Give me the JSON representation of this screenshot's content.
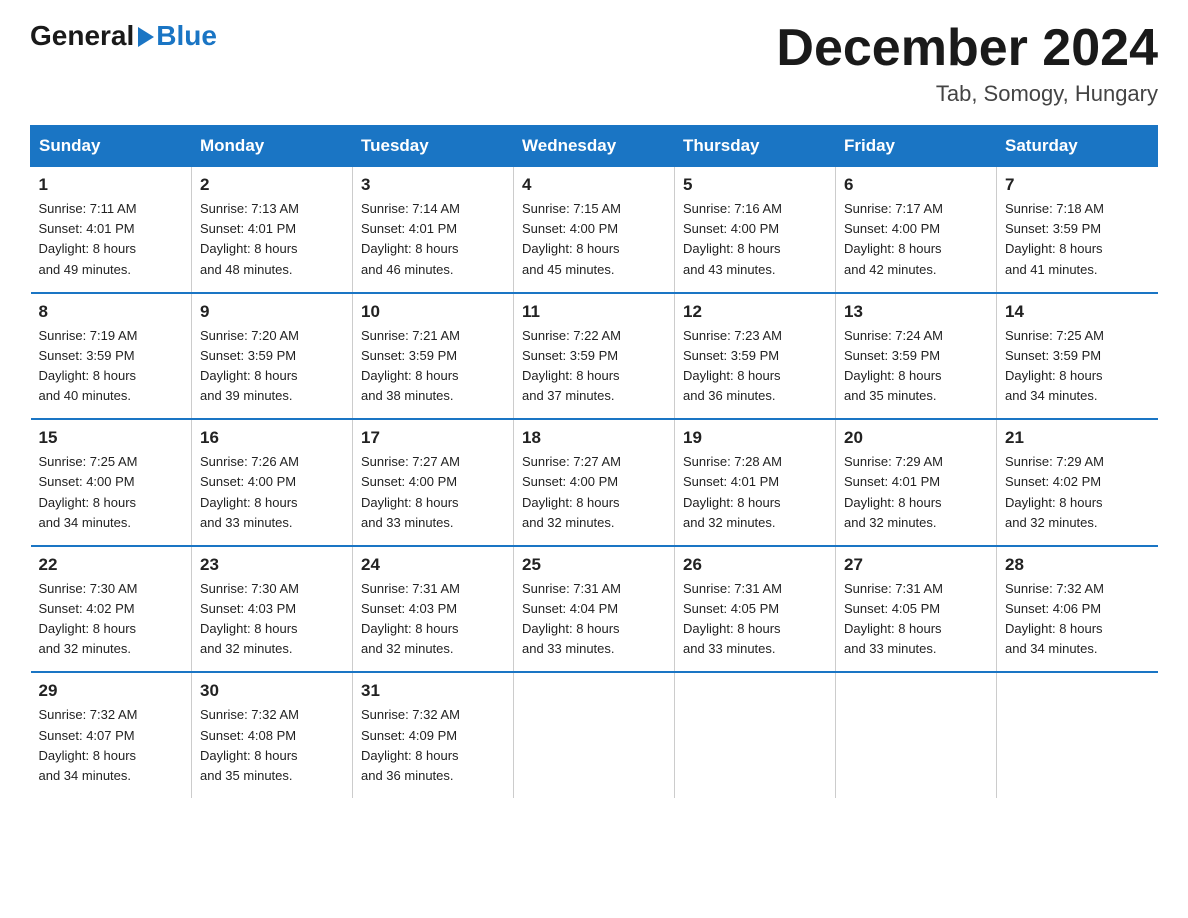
{
  "header": {
    "logo_general": "General",
    "logo_blue": "Blue",
    "month_title": "December 2024",
    "location": "Tab, Somogy, Hungary"
  },
  "days_of_week": [
    "Sunday",
    "Monday",
    "Tuesday",
    "Wednesday",
    "Thursday",
    "Friday",
    "Saturday"
  ],
  "weeks": [
    [
      {
        "day": "1",
        "sunrise": "7:11 AM",
        "sunset": "4:01 PM",
        "daylight": "8 hours and 49 minutes."
      },
      {
        "day": "2",
        "sunrise": "7:13 AM",
        "sunset": "4:01 PM",
        "daylight": "8 hours and 48 minutes."
      },
      {
        "day": "3",
        "sunrise": "7:14 AM",
        "sunset": "4:01 PM",
        "daylight": "8 hours and 46 minutes."
      },
      {
        "day": "4",
        "sunrise": "7:15 AM",
        "sunset": "4:00 PM",
        "daylight": "8 hours and 45 minutes."
      },
      {
        "day": "5",
        "sunrise": "7:16 AM",
        "sunset": "4:00 PM",
        "daylight": "8 hours and 43 minutes."
      },
      {
        "day": "6",
        "sunrise": "7:17 AM",
        "sunset": "4:00 PM",
        "daylight": "8 hours and 42 minutes."
      },
      {
        "day": "7",
        "sunrise": "7:18 AM",
        "sunset": "3:59 PM",
        "daylight": "8 hours and 41 minutes."
      }
    ],
    [
      {
        "day": "8",
        "sunrise": "7:19 AM",
        "sunset": "3:59 PM",
        "daylight": "8 hours and 40 minutes."
      },
      {
        "day": "9",
        "sunrise": "7:20 AM",
        "sunset": "3:59 PM",
        "daylight": "8 hours and 39 minutes."
      },
      {
        "day": "10",
        "sunrise": "7:21 AM",
        "sunset": "3:59 PM",
        "daylight": "8 hours and 38 minutes."
      },
      {
        "day": "11",
        "sunrise": "7:22 AM",
        "sunset": "3:59 PM",
        "daylight": "8 hours and 37 minutes."
      },
      {
        "day": "12",
        "sunrise": "7:23 AM",
        "sunset": "3:59 PM",
        "daylight": "8 hours and 36 minutes."
      },
      {
        "day": "13",
        "sunrise": "7:24 AM",
        "sunset": "3:59 PM",
        "daylight": "8 hours and 35 minutes."
      },
      {
        "day": "14",
        "sunrise": "7:25 AM",
        "sunset": "3:59 PM",
        "daylight": "8 hours and 34 minutes."
      }
    ],
    [
      {
        "day": "15",
        "sunrise": "7:25 AM",
        "sunset": "4:00 PM",
        "daylight": "8 hours and 34 minutes."
      },
      {
        "day": "16",
        "sunrise": "7:26 AM",
        "sunset": "4:00 PM",
        "daylight": "8 hours and 33 minutes."
      },
      {
        "day": "17",
        "sunrise": "7:27 AM",
        "sunset": "4:00 PM",
        "daylight": "8 hours and 33 minutes."
      },
      {
        "day": "18",
        "sunrise": "7:27 AM",
        "sunset": "4:00 PM",
        "daylight": "8 hours and 32 minutes."
      },
      {
        "day": "19",
        "sunrise": "7:28 AM",
        "sunset": "4:01 PM",
        "daylight": "8 hours and 32 minutes."
      },
      {
        "day": "20",
        "sunrise": "7:29 AM",
        "sunset": "4:01 PM",
        "daylight": "8 hours and 32 minutes."
      },
      {
        "day": "21",
        "sunrise": "7:29 AM",
        "sunset": "4:02 PM",
        "daylight": "8 hours and 32 minutes."
      }
    ],
    [
      {
        "day": "22",
        "sunrise": "7:30 AM",
        "sunset": "4:02 PM",
        "daylight": "8 hours and 32 minutes."
      },
      {
        "day": "23",
        "sunrise": "7:30 AM",
        "sunset": "4:03 PM",
        "daylight": "8 hours and 32 minutes."
      },
      {
        "day": "24",
        "sunrise": "7:31 AM",
        "sunset": "4:03 PM",
        "daylight": "8 hours and 32 minutes."
      },
      {
        "day": "25",
        "sunrise": "7:31 AM",
        "sunset": "4:04 PM",
        "daylight": "8 hours and 33 minutes."
      },
      {
        "day": "26",
        "sunrise": "7:31 AM",
        "sunset": "4:05 PM",
        "daylight": "8 hours and 33 minutes."
      },
      {
        "day": "27",
        "sunrise": "7:31 AM",
        "sunset": "4:05 PM",
        "daylight": "8 hours and 33 minutes."
      },
      {
        "day": "28",
        "sunrise": "7:32 AM",
        "sunset": "4:06 PM",
        "daylight": "8 hours and 34 minutes."
      }
    ],
    [
      {
        "day": "29",
        "sunrise": "7:32 AM",
        "sunset": "4:07 PM",
        "daylight": "8 hours and 34 minutes."
      },
      {
        "day": "30",
        "sunrise": "7:32 AM",
        "sunset": "4:08 PM",
        "daylight": "8 hours and 35 minutes."
      },
      {
        "day": "31",
        "sunrise": "7:32 AM",
        "sunset": "4:09 PM",
        "daylight": "8 hours and 36 minutes."
      },
      {
        "day": "",
        "sunrise": "",
        "sunset": "",
        "daylight": ""
      },
      {
        "day": "",
        "sunrise": "",
        "sunset": "",
        "daylight": ""
      },
      {
        "day": "",
        "sunrise": "",
        "sunset": "",
        "daylight": ""
      },
      {
        "day": "",
        "sunrise": "",
        "sunset": "",
        "daylight": ""
      }
    ]
  ]
}
